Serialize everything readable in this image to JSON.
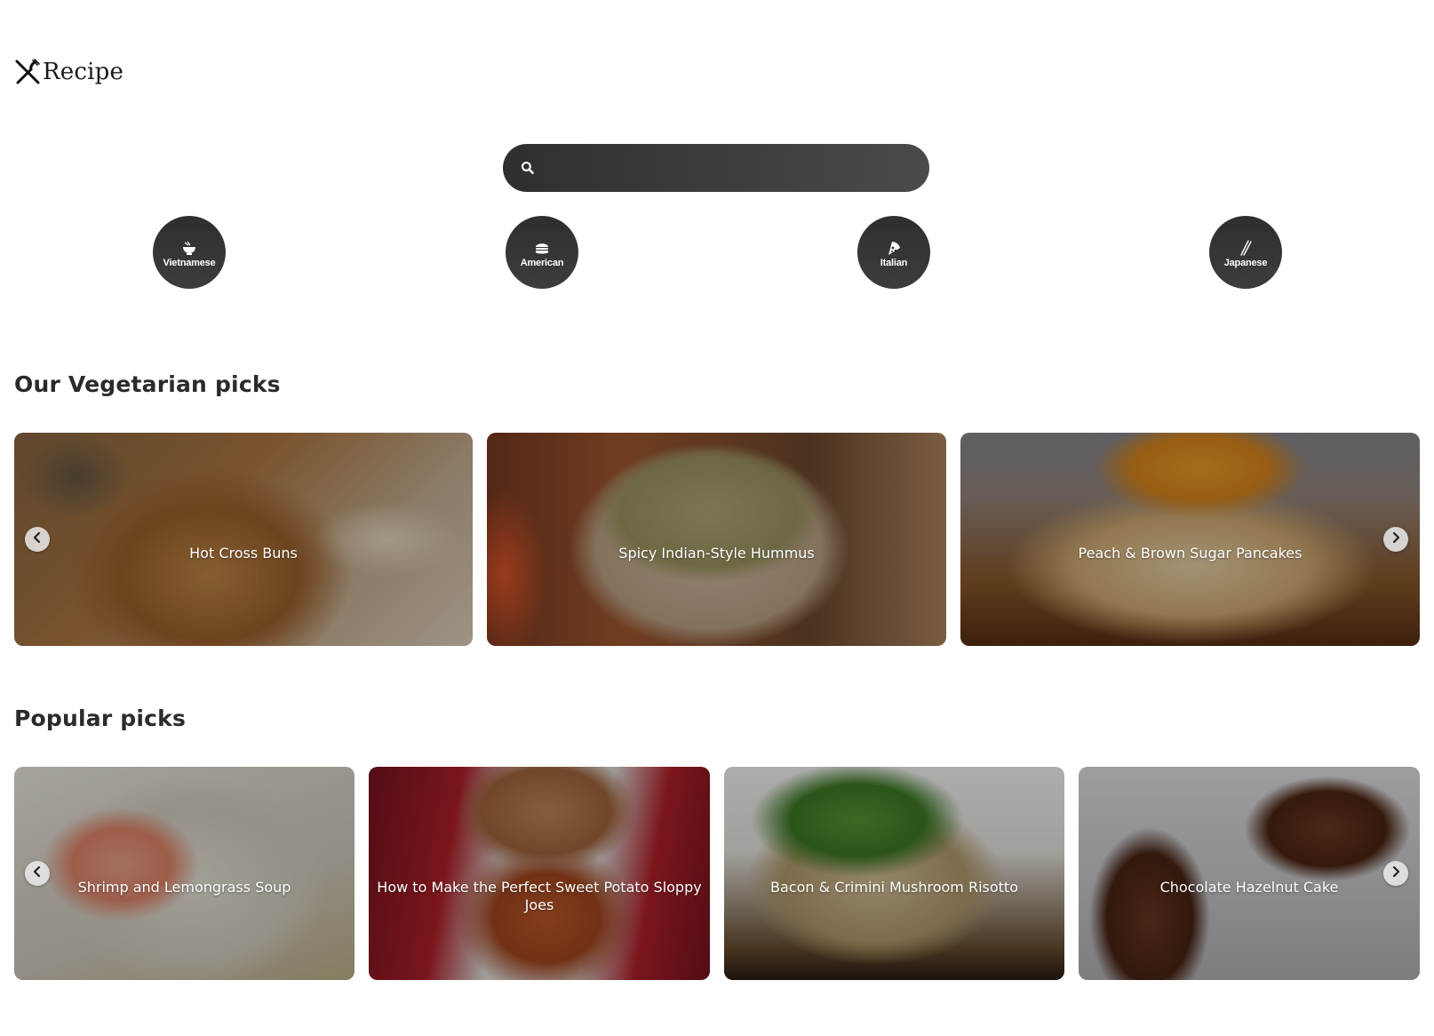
{
  "header": {
    "logo_text": "Recipe",
    "logo_icon": "fork-knife-icon"
  },
  "search": {
    "placeholder": "",
    "value": "",
    "icon": "search-icon"
  },
  "cuisines": [
    {
      "label": "Vietnamese",
      "icon": "noodle-bowl-icon"
    },
    {
      "label": "American",
      "icon": "burger-icon"
    },
    {
      "label": "Italian",
      "icon": "pizza-icon"
    },
    {
      "label": "Japanese",
      "icon": "chopsticks-icon"
    }
  ],
  "vegetarian": {
    "title": "Our Vegetarian picks",
    "cards": [
      {
        "title": "Hot Cross Buns"
      },
      {
        "title": "Spicy Indian-Style Hummus"
      },
      {
        "title": "Peach & Brown Sugar Pancakes"
      }
    ]
  },
  "popular": {
    "title": "Popular picks",
    "cards": [
      {
        "title": "Shrimp and Lemongrass Soup"
      },
      {
        "title": "How to Make the Perfect Sweet Potato Sloppy Joes"
      },
      {
        "title": "Bacon & Crimini Mushroom Risotto"
      },
      {
        "title": "Chocolate Hazelnut Cake"
      }
    ]
  },
  "colors": {
    "dark": "#333333",
    "accent": "#ffffff"
  }
}
